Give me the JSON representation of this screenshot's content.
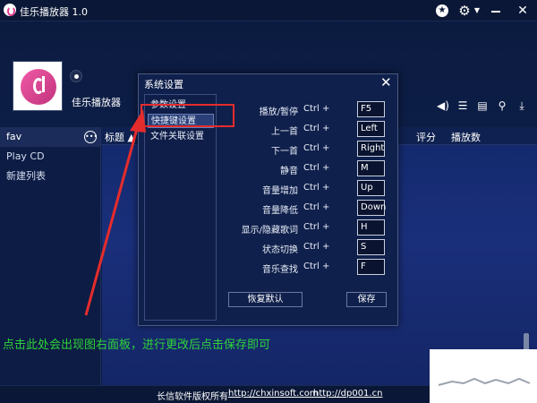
{
  "window": {
    "title": "佳乐播放器 1.0"
  },
  "header": {
    "player_name": "佳乐播放器"
  },
  "sidebar": {
    "items": [
      {
        "label": "fav"
      },
      {
        "label": "Play CD"
      },
      {
        "label": "新建列表"
      }
    ]
  },
  "list": {
    "columns": {
      "title": "标题",
      "rating": "评分",
      "plays": "播放数"
    }
  },
  "dialog": {
    "title": "系统设置",
    "menu": [
      {
        "label": "参数设置"
      },
      {
        "label": "快捷键设置",
        "selected": true
      },
      {
        "label": "文件关联设置"
      }
    ],
    "shortcuts": [
      {
        "label": "播放/暂停",
        "modifier": "Ctrl +",
        "key": "F5"
      },
      {
        "label": "上一首",
        "modifier": "Ctrl +",
        "key": "Left"
      },
      {
        "label": "下一首",
        "modifier": "Ctrl +",
        "key": "Right"
      },
      {
        "label": "静音",
        "modifier": "Ctrl +",
        "key": "M"
      },
      {
        "label": "音量增加",
        "modifier": "Ctrl +",
        "key": "Up"
      },
      {
        "label": "音量降低",
        "modifier": "Ctrl +",
        "key": "Down"
      },
      {
        "label": "显示/隐藏歌词",
        "modifier": "Ctrl +",
        "key": "H"
      },
      {
        "label": "状态切换",
        "modifier": "Ctrl +",
        "key": "S"
      },
      {
        "label": "音乐查找",
        "modifier": "Ctrl +",
        "key": "F"
      }
    ],
    "reset_label": "恢复默认",
    "save_label": "保存"
  },
  "annotation": "点击此处会出现图右面板，进行更改后点击保存即可",
  "footer": {
    "copyright": "长信软件版权所有",
    "link1": "http://chxinsoft.com",
    "link2": "http://dp001.cn"
  },
  "colors": {
    "annotation": "#2fd43a",
    "highlight": "#e52c2c",
    "background": "#0b1a3e"
  }
}
